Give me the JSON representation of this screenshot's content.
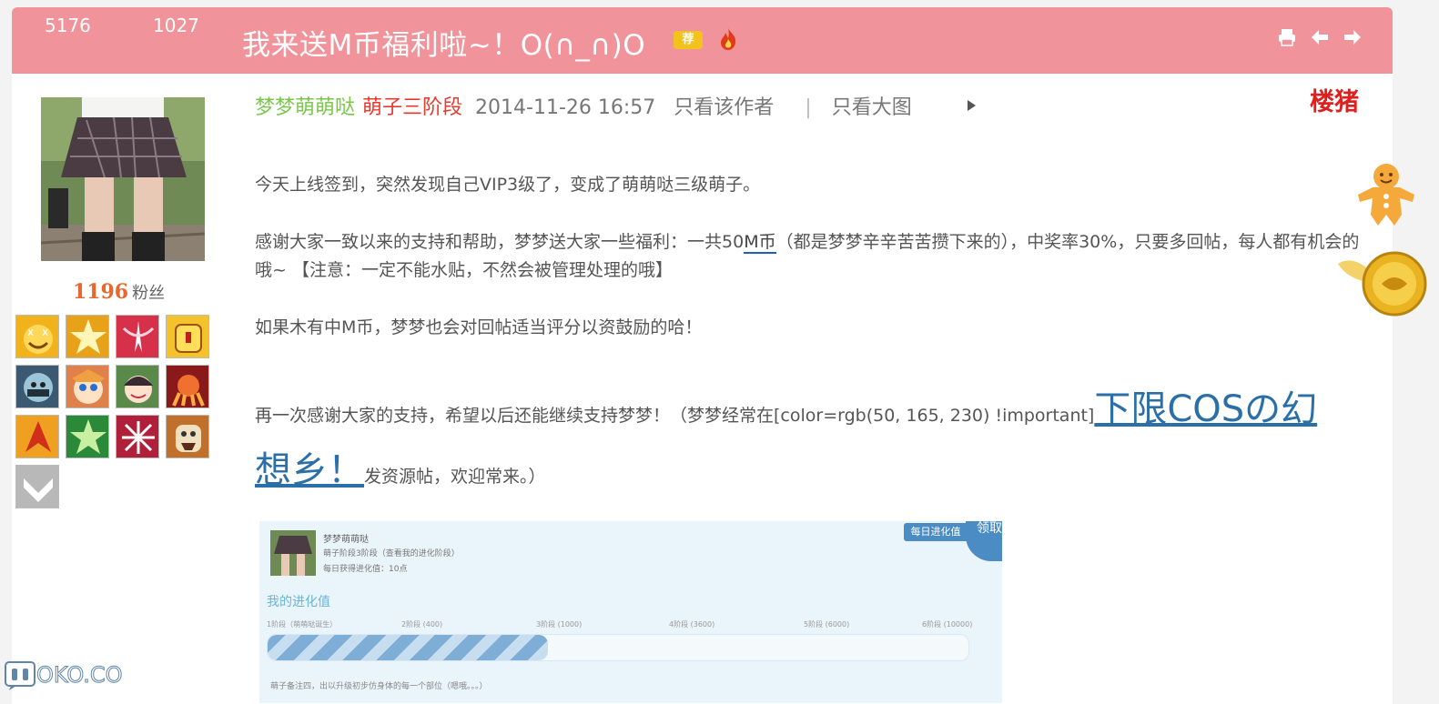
{
  "header": {
    "views": "5176",
    "replies": "1027",
    "title": "我来送M币福利啦~！O(∩_∩)O",
    "recommend_badge": "荐",
    "bg_color": "#f0939a"
  },
  "author": {
    "name": "梦梦萌萌哒",
    "rank": "萌子三阶段",
    "time": "2014-11-26 16:57",
    "only_author": "只看该作者",
    "separator": "|",
    "only_images": "只看大图",
    "floor_tag": "楼猪",
    "fans_count": "1196",
    "fans_label": "粉丝"
  },
  "content": {
    "p1": "今天上线签到，突然发现自己VIP3级了，变成了萌萌哒三级萌子。",
    "p2_a": "感谢大家一致以来的支持和帮助，梦梦送大家一些福利：一共50",
    "p2_link": "M币",
    "p2_b": "（都是梦梦辛辛苦苦攒下来的），中奖率30%，只要多回帖，每人都有机会的哦~ 【注意：一定不能水贴，不然会被管理处理的哦】",
    "p3": "如果木有中M币，梦梦也会对回帖适当评分以资鼓励的哈！",
    "p4_a": "再一次感谢大家的支持，希望以后还能继续支持梦梦！（梦梦经常在[color=rgb(50, 165, 230) !important]",
    "p4_link": "下限COSの幻想乡！",
    "p4_b": "发资源帖，欢迎常来。）"
  },
  "screenshot": {
    "name": "梦梦萌萌哒",
    "stage": "萌子阶段3阶段（查看我的进化阶段）",
    "daily": "每日获得进化值：10点",
    "daily_btn": "每日进化值",
    "claim": "领取",
    "section_title": "我的进化值",
    "ticks": [
      "1阶段（萌萌哒诞生）",
      "2阶段 (400)",
      "3阶段 (1000)",
      "4阶段 (3600)",
      "5阶段 (6000)",
      "6阶段 (10000)"
    ],
    "progress": 0.4,
    "footer": "萌子备注四，出以升级初步仿身体的每一个部位（嗯哦。。。）"
  },
  "site_logo": "OKO.CO"
}
